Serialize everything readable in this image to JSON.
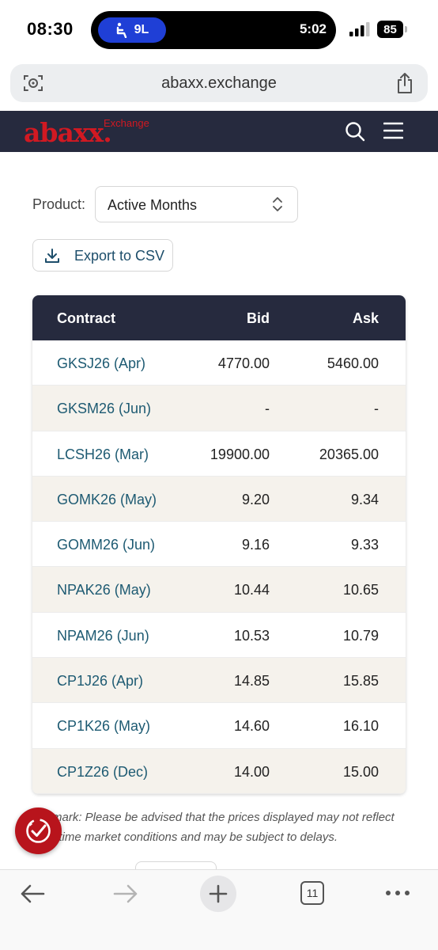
{
  "status_bar": {
    "time": "08:30",
    "island_pill": "9L",
    "island_timer": "5:02",
    "battery": "85"
  },
  "browser": {
    "url": "abaxx.exchange"
  },
  "site": {
    "logo": "abaxx.",
    "logo_sub": "Exchange"
  },
  "filters": {
    "product_label": "Product:",
    "product_value": "Active Months",
    "export_label": "Export to CSV"
  },
  "table": {
    "headers": {
      "contract": "Contract",
      "bid": "Bid",
      "ask": "Ask"
    },
    "rows": [
      {
        "contract": "GKSJ26 (Apr)",
        "bid": "4770.00",
        "ask": "5460.00"
      },
      {
        "contract": "GKSM26 (Jun)",
        "bid": "-",
        "ask": "-"
      },
      {
        "contract": "LCSH26 (Mar)",
        "bid": "19900.00",
        "ask": "20365.00"
      },
      {
        "contract": "GOMK26 (May)",
        "bid": "9.20",
        "ask": "9.34"
      },
      {
        "contract": "GOMM26 (Jun)",
        "bid": "9.16",
        "ask": "9.33"
      },
      {
        "contract": "NPAK26 (May)",
        "bid": "10.44",
        "ask": "10.65"
      },
      {
        "contract": "NPAM26 (Jun)",
        "bid": "10.53",
        "ask": "10.79"
      },
      {
        "contract": "CP1J26 (Apr)",
        "bid": "14.85",
        "ask": "15.85"
      },
      {
        "contract": "CP1K26 (May)",
        "bid": "14.60",
        "ask": "16.10"
      },
      {
        "contract": "CP1Z26 (Dec)",
        "bid": "14.00",
        "ask": "15.00"
      }
    ]
  },
  "remark": {
    "line1": "mark: Please be advised that the prices displayed may not reflect",
    "line2": "l-time market conditions and may be subject to delays."
  },
  "toolbar": {
    "tab_count": "11"
  },
  "colors": {
    "header_bg": "#262a3e",
    "brand_red": "#d11922",
    "link_teal": "#1d5a72",
    "row_alt": "#f5f2ec"
  },
  "icons": {
    "url_left": "page-settings-icon",
    "url_right": "share-icon",
    "header_search": "search-icon",
    "header_menu": "hamburger-menu-icon",
    "export": "download-icon",
    "select": "up-down-chevron-icon",
    "badge": "checklist-badge-icon",
    "toolbar": [
      "back-arrow-icon",
      "forward-arrow-icon",
      "plus-icon",
      "tabs-icon",
      "more-icon"
    ]
  }
}
